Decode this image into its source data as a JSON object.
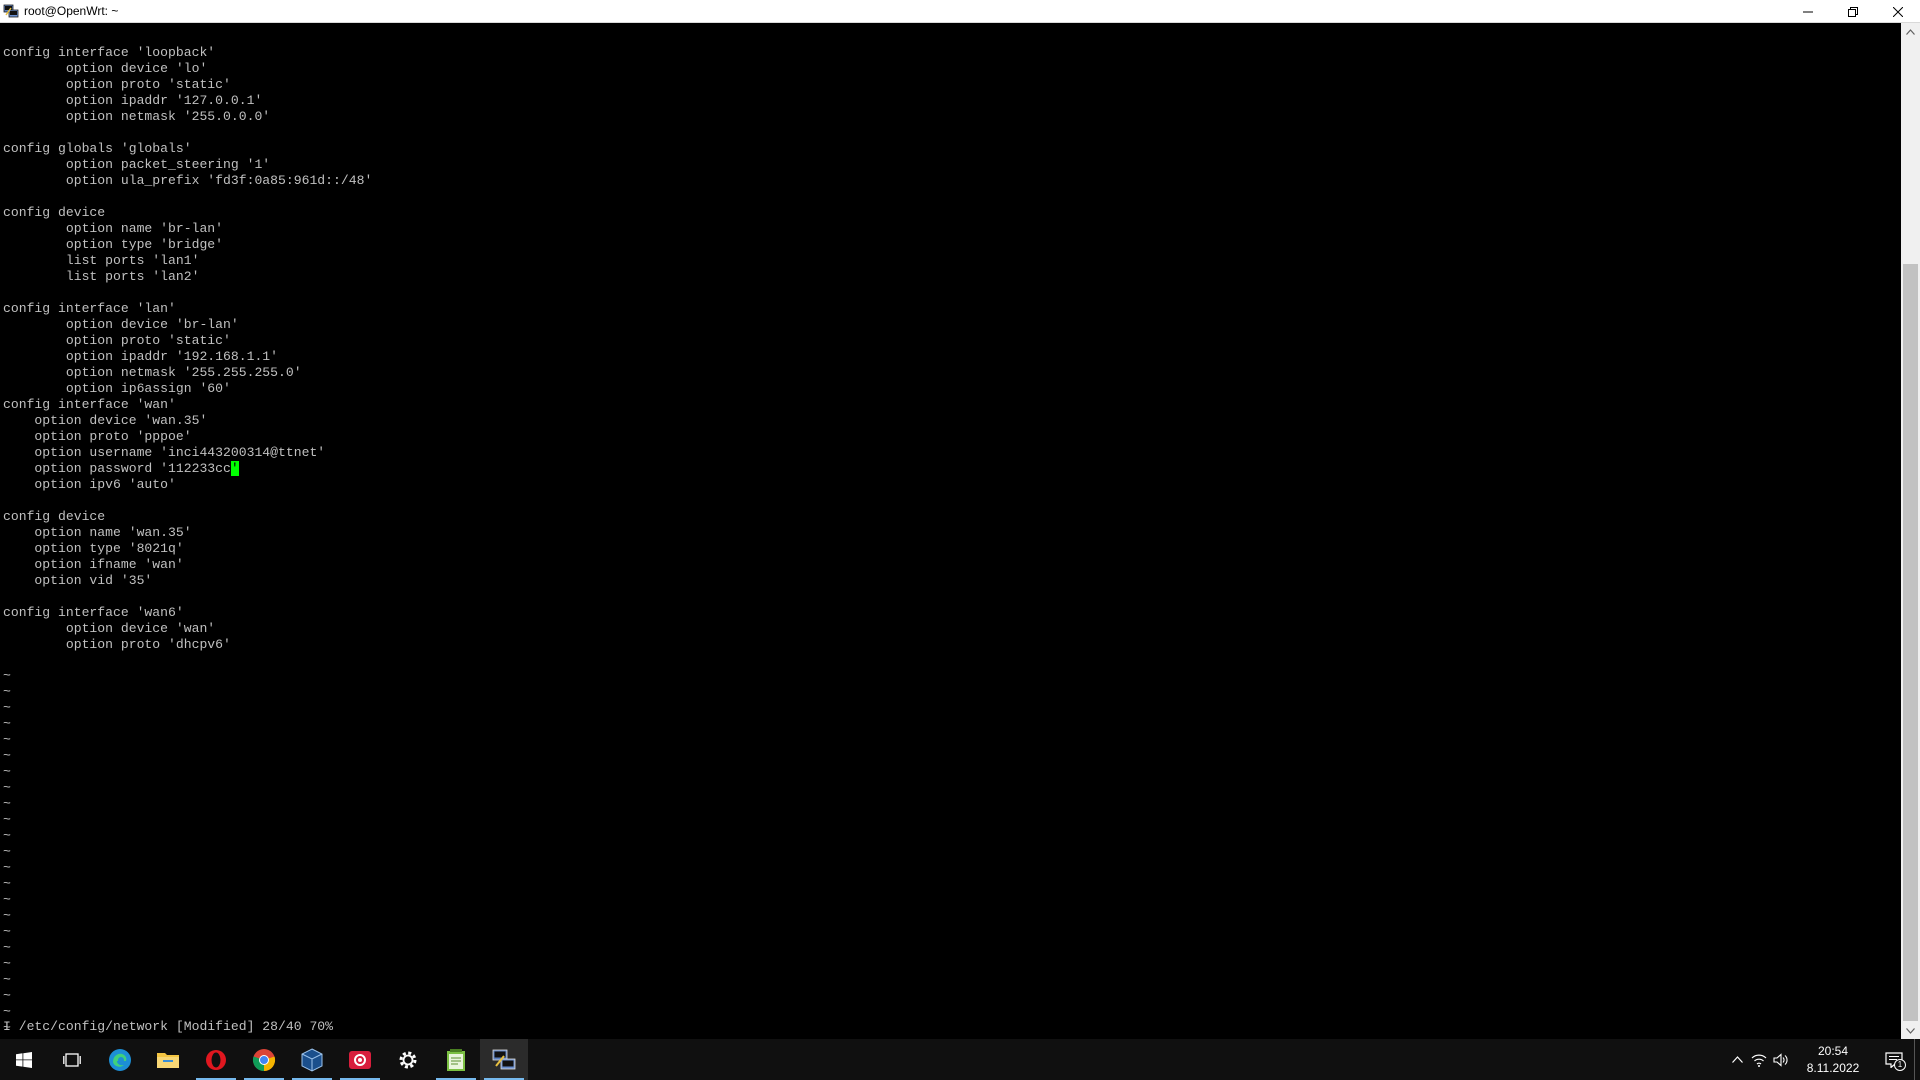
{
  "window": {
    "title": "root@OpenWrt: ~"
  },
  "terminal": {
    "lines": [
      "config interface 'loopback'",
      "        option device 'lo'",
      "        option proto 'static'",
      "        option ipaddr '127.0.0.1'",
      "        option netmask '255.0.0.0'",
      "",
      "config globals 'globals'",
      "        option packet_steering '1'",
      "        option ula_prefix 'fd3f:0a85:961d::/48'",
      "",
      "config device",
      "        option name 'br-lan'",
      "        option type 'bridge'",
      "        list ports 'lan1'",
      "        list ports 'lan2'",
      "",
      "config interface 'lan'",
      "        option device 'br-lan'",
      "        option proto 'static'",
      "        option ipaddr '192.168.1.1'",
      "        option netmask '255.255.255.0'",
      "        option ip6assign '60'",
      "config interface 'wan'",
      "    option device 'wan.35'",
      "    option proto 'pppoe'",
      "    option username 'inci443200314@ttnet'",
      "    option password '112233cc",
      "    option ipv6 'auto'",
      "",
      "config device",
      "    option name 'wan.35'",
      "    option type '8021q'",
      "    option ifname 'wan'",
      "    option vid '35'",
      "",
      "config interface 'wan6'",
      "        option device 'wan'",
      "        option proto 'dhcpv6'"
    ],
    "cursor_char": "'",
    "tilde": "~",
    "status": "I /etc/config/network [Modified] 28/40 70%"
  },
  "taskbar": {
    "apps": [
      "start-icon",
      "task-view-icon",
      "edge-icon",
      "file-explorer-icon",
      "opera-icon",
      "chrome-icon",
      "virtualbox-icon",
      "screen-recorder-icon",
      "settings-icon",
      "notepad-icon",
      "putty-icon"
    ],
    "clock_time": "20:54",
    "clock_date": "8.11.2022",
    "notification_count": "1"
  },
  "colors": {
    "terminal_bg": "#000000",
    "terminal_fg": "#c0c0c0",
    "cursor": "#00ff00",
    "taskbar_bg": "#101010",
    "running_indicator": "#76b9ed"
  }
}
